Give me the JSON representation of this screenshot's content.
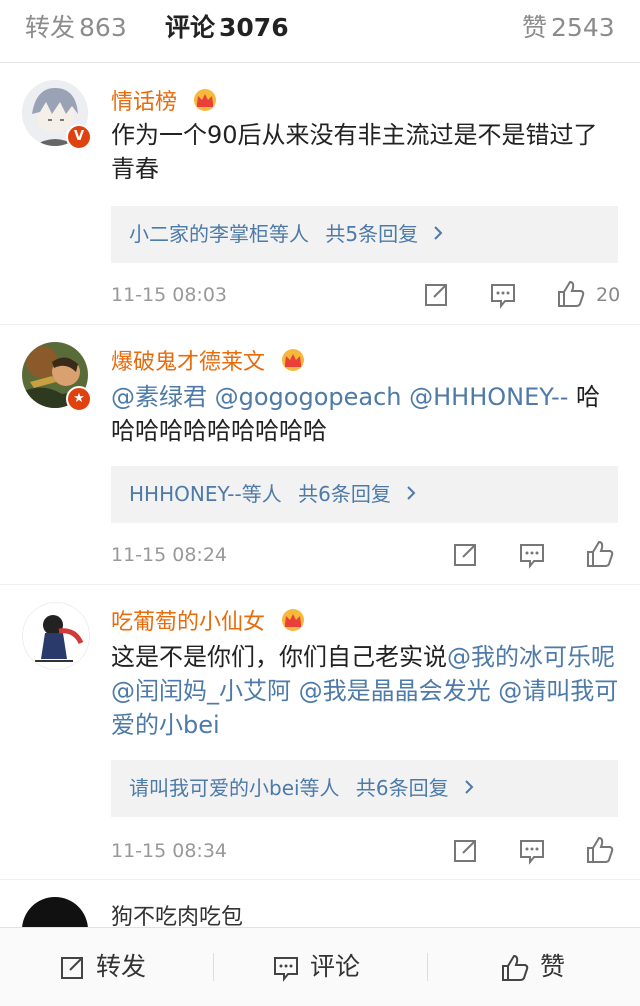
{
  "tabs": {
    "repost_label": "转发",
    "repost_count": "863",
    "comment_label": "评论",
    "comment_count": "3076",
    "like_label": "赞",
    "like_count": "2543"
  },
  "comments": [
    {
      "name": "情话榜",
      "text": "作为一个90后从来没有非主流过是不是错过了青春",
      "reply_summary": "小二家的李掌柜等人",
      "reply_count": "共5条回复",
      "time": "11-15 08:03",
      "likes": "20"
    },
    {
      "name": "爆破鬼才德莱文",
      "text_parts": [
        "@素绿君 @gogogopeach @HHHONEY--",
        " 哈哈哈哈哈哈哈哈哈哈"
      ],
      "reply_summary": "HHHONEY--等人",
      "reply_count": "共6条回复",
      "time": "11-15 08:24"
    },
    {
      "name": "吃葡萄的小仙女",
      "text_parts": [
        "这是不是你们，你们自己老实说",
        "@我的冰可乐呢 @闰闰妈_小艾阿 @我是晶晶会发光 @请叫我可爱的小bei"
      ],
      "reply_summary": "请叫我可爱的小bei等人",
      "reply_count": "共6条回复",
      "time": "11-15 08:34"
    },
    {
      "name": "狗不吃肉吃包"
    }
  ],
  "bottom_bar": {
    "repost": "转发",
    "comment": "评论",
    "like": "赞"
  },
  "colors": {
    "username": "#e86b0c",
    "mention": "#4d7aa8",
    "verified_badge": "#e0420f"
  }
}
